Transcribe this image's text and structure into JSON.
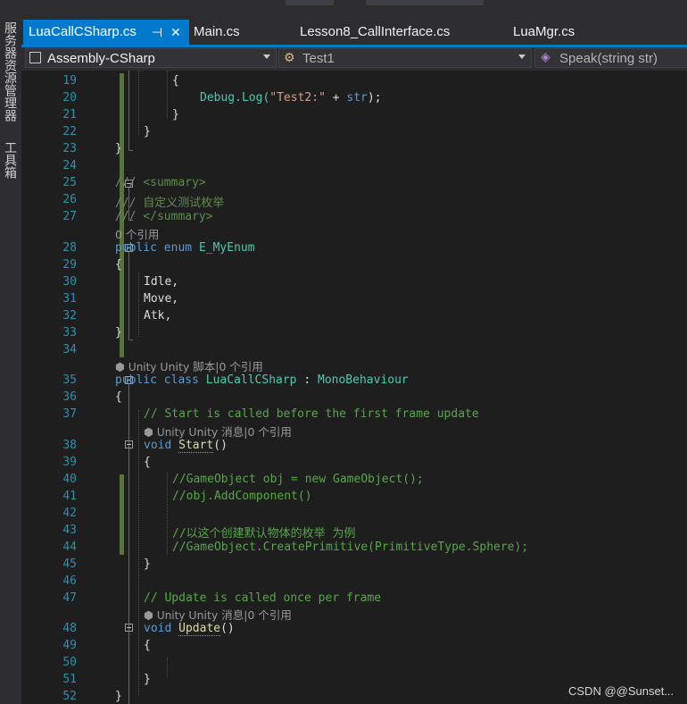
{
  "side_panel": {
    "server_explorer": "服务器资源管理器",
    "toolbox": "工具箱"
  },
  "tabs": [
    {
      "label": "LuaCallCSharp.cs",
      "active": true,
      "pin_icon": "pin-icon",
      "close_icon": "close-icon"
    },
    {
      "label": "Main.cs"
    },
    {
      "label": "Lesson8_CallInterface.cs"
    },
    {
      "label": "LuaMgr.cs"
    }
  ],
  "navbar": {
    "project": "Assembly-CSharp",
    "type": "Test1",
    "member": "Speak(string str)"
  },
  "codelens": {
    "refs0": "0 个引用",
    "unity_script": "Unity 脚本",
    "unity_message": "Unity 消息",
    "sep": "|",
    "refs_ref": "0 个引用"
  },
  "code": {
    "l19": "{",
    "l20_a": "Debug.Log(",
    "l20_b": "\"Test2:\"",
    "l20_c": " + ",
    "l20_d": "str",
    "l20_e": ");",
    "l21": "}",
    "l22": "}",
    "l23": "}",
    "l25_a": "///",
    "l25_b": " <summary>",
    "l26_a": "///",
    "l26_b": " 自定义测试枚举",
    "l27_a": "///",
    "l27_b": " </summary>",
    "l28_a": "public",
    "l28_b": "enum",
    "l28_c": "E_MyEnum",
    "l29": "{",
    "l30": "Idle,",
    "l31": "Move,",
    "l32": "Atk,",
    "l33": "}",
    "l35_a": "public",
    "l35_b": "class",
    "l35_c": "LuaCallCSharp",
    "l35_d": " : ",
    "l35_e": "MonoBehaviour",
    "l36": "{",
    "l37": "// Start is called before the first frame update",
    "l38_a": "void",
    "l38_b": "Start",
    "l38_c": "()",
    "l39": "{",
    "l40": "//GameObject obj = new GameObject();",
    "l41": "//obj.AddComponent()",
    "l43": "//以这个创建默认物体的枚举 为例",
    "l44": "//GameObject.CreatePrimitive(PrimitiveType.Sphere);",
    "l45": "}",
    "l47": "// Update is called once per frame",
    "l48_a": "void",
    "l48_b": "Update",
    "l48_c": "()",
    "l49": "{",
    "l51": "}",
    "l52": "}"
  },
  "line_numbers": [
    "19",
    "20",
    "21",
    "22",
    "23",
    "24",
    "25",
    "26",
    "27",
    "28",
    "29",
    "30",
    "31",
    "32",
    "33",
    "34",
    "35",
    "36",
    "37",
    "38",
    "39",
    "40",
    "41",
    "42",
    "43",
    "44",
    "45",
    "46",
    "47",
    "48",
    "49",
    "50",
    "51",
    "52"
  ],
  "watermark": "CSDN @@Sunset..."
}
